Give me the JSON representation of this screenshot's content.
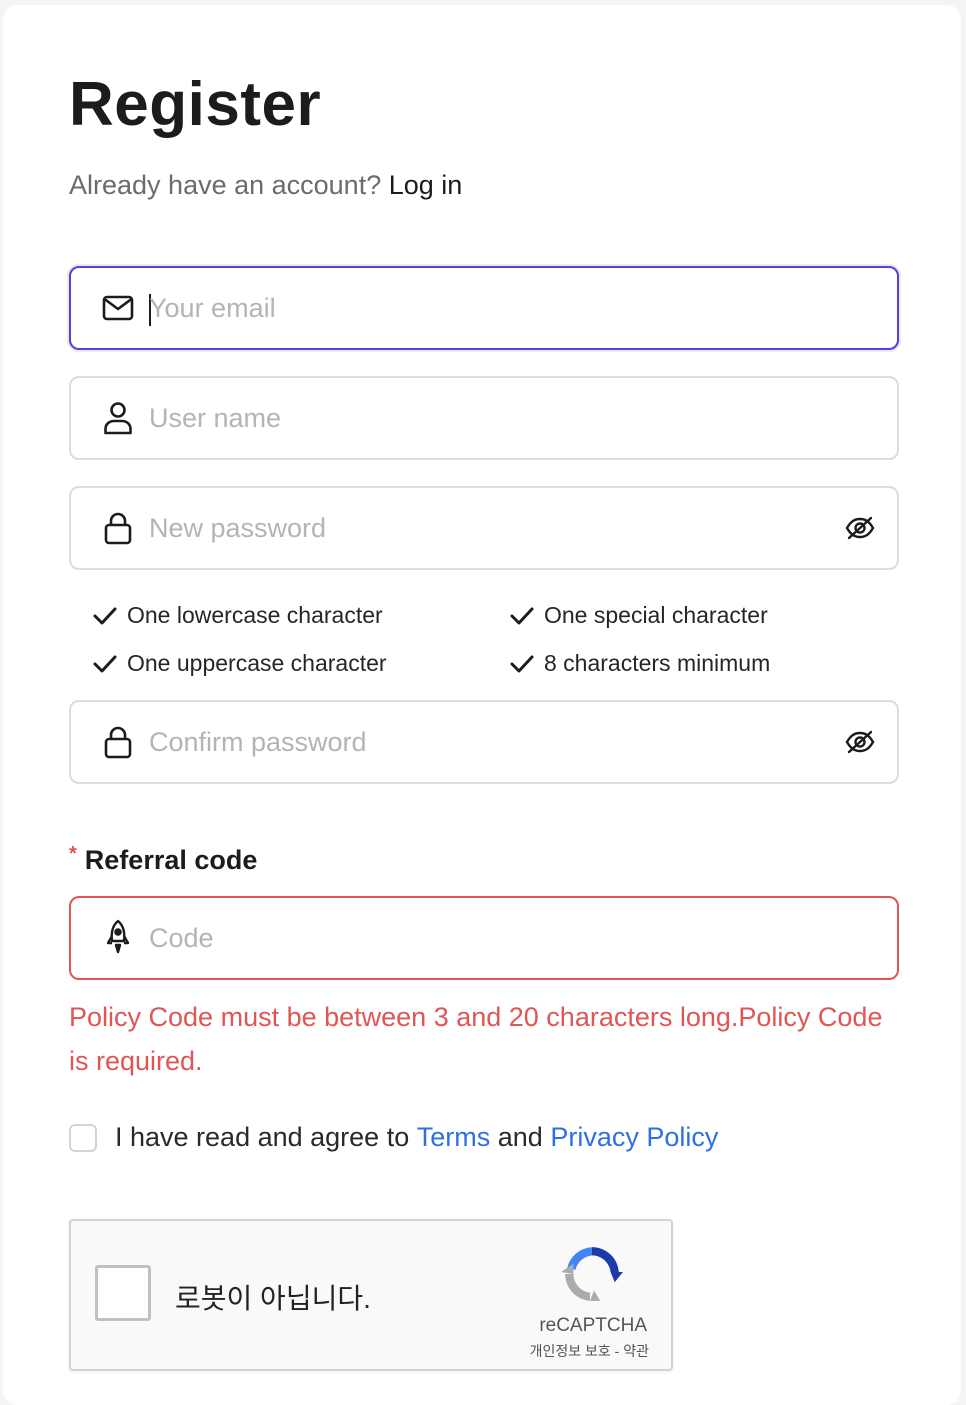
{
  "title": "Register",
  "login_prompt": {
    "text": "Already have an account?",
    "link": "Log in"
  },
  "fields": {
    "email": {
      "placeholder": "Your email",
      "icon": "envelope-icon",
      "state": "focused"
    },
    "username": {
      "placeholder": "User name",
      "icon": "user-icon"
    },
    "new_password": {
      "placeholder": "New password",
      "icon": "lock-icon",
      "toggle_icon": "eye-off-icon"
    },
    "confirm_password": {
      "placeholder": "Confirm password",
      "icon": "lock-icon",
      "toggle_icon": "eye-off-icon"
    },
    "referral_code": {
      "placeholder": "Code",
      "icon": "rocket-icon",
      "state": "error"
    }
  },
  "password_requirements": [
    "One lowercase character",
    "One special character",
    "One uppercase character",
    "8 characters minimum"
  ],
  "referral": {
    "required_mark": "*",
    "label": "Referral code",
    "error": "Policy Code must be between 3 and 20 characters long.Policy Code is required."
  },
  "agreement": {
    "prefix": "I have read and agree to",
    "terms_link": "Terms",
    "conjunction": "and",
    "privacy_link": "Privacy Policy"
  },
  "captcha": {
    "label": "로봇이 아닙니다.",
    "brand": "reCAPTCHA",
    "privacy": "개인정보 보호",
    "separator": "-",
    "terms": "약관"
  },
  "colors": {
    "accent_focus": "#5b3fd6",
    "error": "#e05555",
    "link": "#2f6fe4"
  }
}
